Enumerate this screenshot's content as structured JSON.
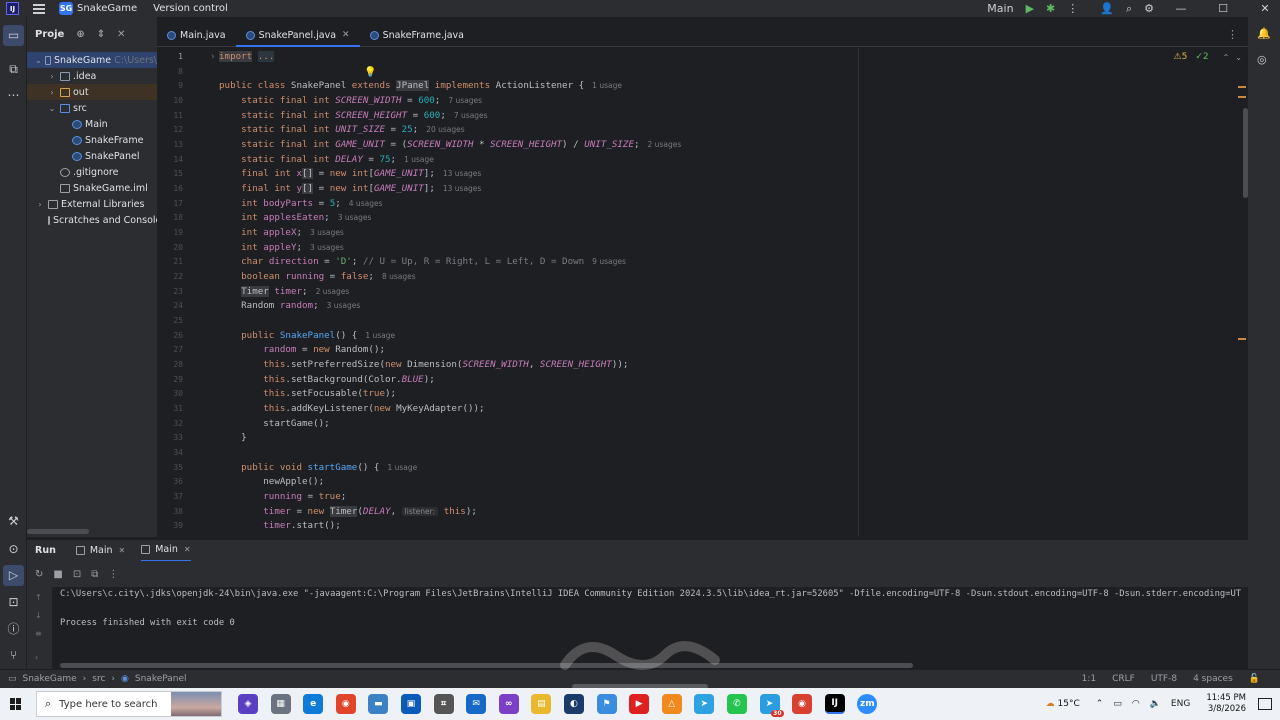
{
  "titlebar": {
    "project_badge": "SG",
    "project_name": "SnakeGame",
    "vcs": "Version control",
    "run_config": "Main"
  },
  "project_panel": {
    "title": "Proje",
    "items": [
      {
        "label": "SnakeGame",
        "path": "C:\\Users\\"
      },
      {
        "label": ".idea"
      },
      {
        "label": "out"
      },
      {
        "label": "src"
      },
      {
        "label": "Main"
      },
      {
        "label": "SnakeFrame"
      },
      {
        "label": "SnakePanel"
      },
      {
        "label": ".gitignore"
      },
      {
        "label": "SnakeGame.iml"
      },
      {
        "label": "External Libraries"
      },
      {
        "label": "Scratches and Console"
      }
    ]
  },
  "editor_tabs": [
    {
      "label": "Main.java"
    },
    {
      "label": "SnakePanel.java"
    },
    {
      "label": "SnakeFrame.java"
    }
  ],
  "inspections": {
    "warnings": "5",
    "ok": "2"
  },
  "line_numbers": [
    "1",
    "8",
    "9",
    "10",
    "11",
    "12",
    "13",
    "14",
    "15",
    "16",
    "17",
    "18",
    "19",
    "20",
    "21",
    "22",
    "23",
    "24",
    "25",
    "26",
    "27",
    "28",
    "29",
    "30",
    "31",
    "32",
    "33",
    "34",
    "35",
    "36",
    "37",
    "38",
    "39"
  ],
  "code": {
    "import_kw": "import",
    "import_fold": "...",
    "usages": {
      "u1": "1 usage",
      "u7": "7 usages",
      "u20": "20 usages",
      "u2": "2 usages",
      "u13": "13 usages",
      "u4": "4 usages",
      "u3": "3 usages",
      "u9": "9 usages",
      "u8": "8 usages"
    },
    "comment_dir": "// U = Up, R = Right, L = Left, D = Down",
    "char_d": "'D'",
    "param_hint": "listener:"
  },
  "run_panel": {
    "title": "Run",
    "tabs": [
      {
        "label": "Main"
      },
      {
        "label": "Main"
      }
    ],
    "command": "C:\\Users\\c.city\\.jdks\\openjdk-24\\bin\\java.exe \"-javaagent:C:\\Program Files\\JetBrains\\IntelliJ IDEA Community Edition 2024.3.5\\lib\\idea_rt.jar=52605\" -Dfile.encoding=UTF-8 -Dsun.stdout.encoding=UTF-8 -Dsun.stderr.encoding=UT",
    "exit": "Process finished with exit code 0"
  },
  "statusbar": {
    "crumbs": [
      "SnakeGame",
      "src",
      "SnakePanel"
    ],
    "position": "1:1",
    "line_sep": "CRLF",
    "encoding": "UTF-8",
    "indent": "4 spaces"
  },
  "taskbar": {
    "search_placeholder": "Type here to search",
    "temp": "15°C",
    "lang": "ENG",
    "time": "11:45 PM",
    "date": "3/8/2026",
    "badge": "30"
  }
}
